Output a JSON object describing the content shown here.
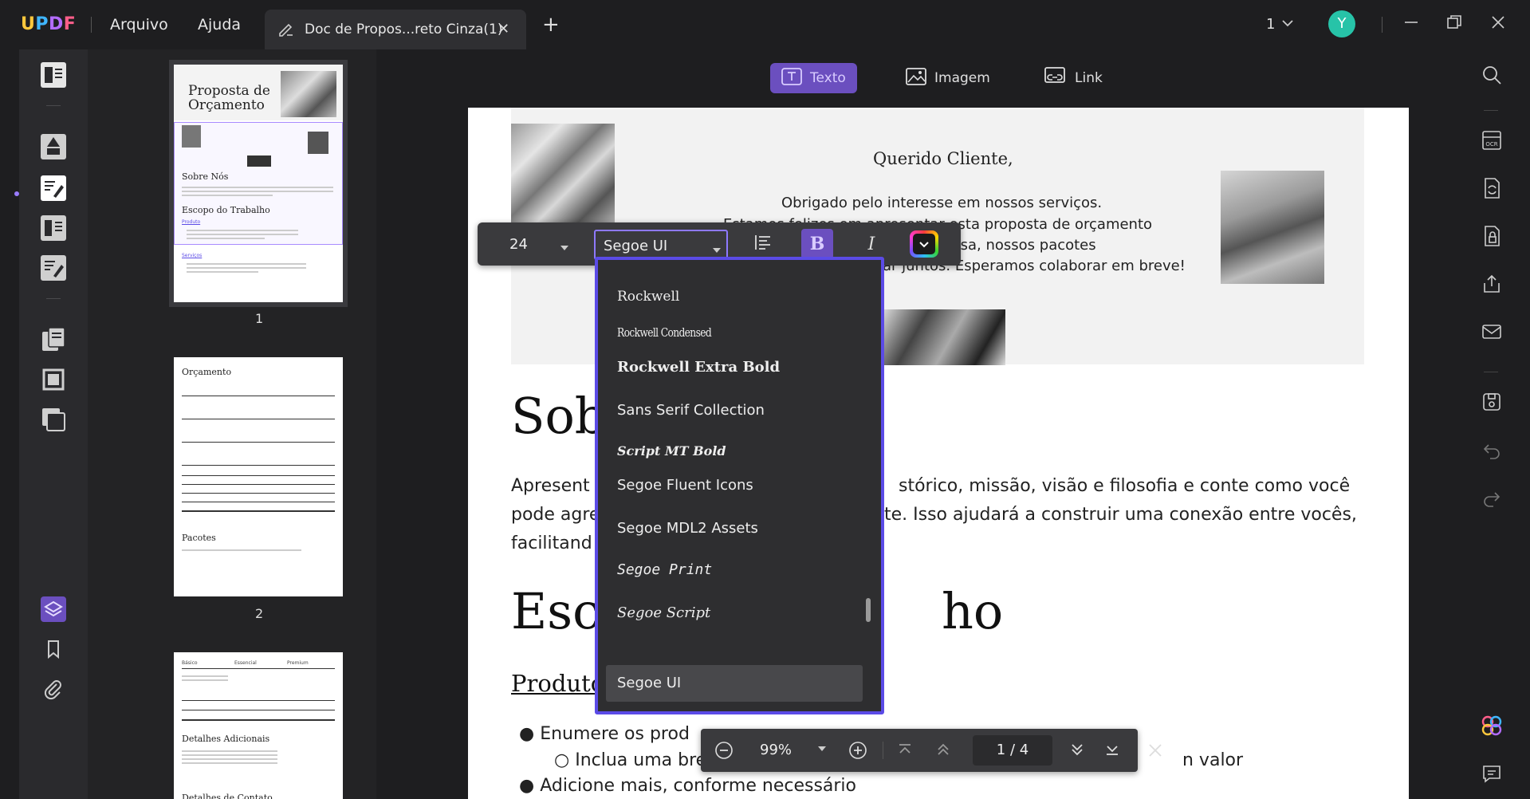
{
  "titlebar": {
    "logo": {
      "u": "U",
      "p": "P",
      "d": "D",
      "f": "F"
    },
    "menu": [
      "Arquivo",
      "Ajuda"
    ],
    "tab_title": "Doc de Propos...reto Cinza(1)",
    "page_selector": "1",
    "avatar_initial": "Y"
  },
  "top_tools": {
    "text": "Texto",
    "image": "Imagem",
    "link": "Link"
  },
  "thumbnails": {
    "page_numbers": [
      "1",
      "2"
    ],
    "p1": {
      "title_line1": "Proposta de",
      "title_line2": "Orçamento",
      "sobre": "Sobre Nós",
      "escopo": "Escopo do Trabalho",
      "produto": "Produto",
      "servicos": "Serviços"
    },
    "p2": {
      "orcamento": "Orçamento",
      "pacotes": "Pacotes"
    },
    "p3": {
      "basico": "Básico",
      "essencial": "Essencial",
      "premium": "Premium",
      "detalhes": "Detalhes Adicionais",
      "contato": "Detalhes de Contato"
    }
  },
  "document": {
    "greeting": "Querido Cliente,",
    "hero_line1": "Obrigado pelo interesse em nossos serviços.",
    "hero_line2_a": "Estamos felizes em apresentar esta proposta de orçamento",
    "hero_line3_b": "ssa empresa, nossos pacotes",
    "hero_line4_b": "ar juntos. Esperamos colaborar em breve!",
    "sobre_partial": "Sob",
    "body_line1_a": "Apresent",
    "body_line1_b": "stórico, missão, visão e filosofia e conte como você",
    "body_line2_a": "pode agre",
    "body_line2_b": "te. Isso ajudará a construir uma conexão entre vocês,",
    "body_line3_a": "facilitand",
    "escopo_partial_a": "Esc",
    "escopo_partial_b": "ho",
    "produto_partial": "Produto",
    "bullet1": "Enumere os prod",
    "sub_bullet1_a": "Inclua uma bre",
    "sub_bullet1_b": "n valor",
    "bullet2": "Adicione mais, conforme necessário"
  },
  "font_toolbar": {
    "size": "24",
    "font": "Segoe UI",
    "bold": "B",
    "italic": "I"
  },
  "font_list": [
    "Rockwell",
    "Rockwell Condensed",
    "Rockwell Extra Bold",
    "Sans Serif Collection",
    "Script MT Bold",
    "Segoe Fluent Icons",
    "Segoe MDL2 Assets",
    "Segoe Print",
    "Segoe Script",
    "Segoe UI"
  ],
  "zoom_bar": {
    "zoom": "99%",
    "page_indicator": "1 / 4"
  },
  "colors": {
    "accent": "#6b4fbf",
    "dropdown_border": "#5b4be6",
    "avatar": "#27c3a8"
  }
}
